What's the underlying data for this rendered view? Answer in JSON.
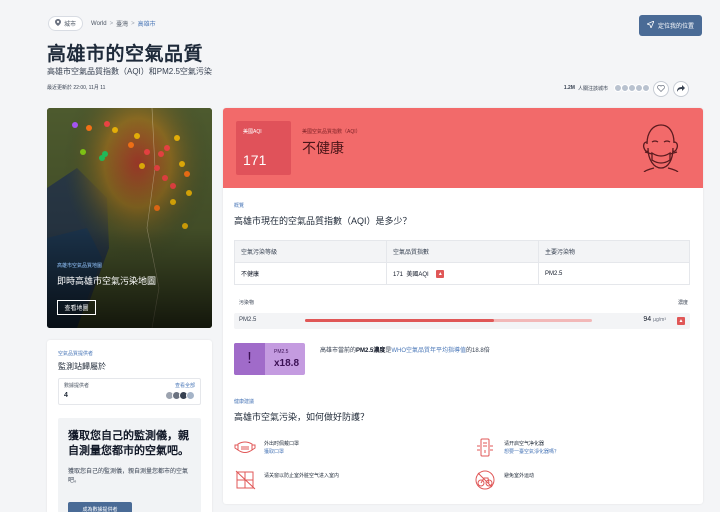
{
  "breadcrumb": {
    "pill": "城市",
    "items": [
      "World",
      "臺灣",
      "高雄市"
    ]
  },
  "header": {
    "locate_label": "定位我的位置",
    "title": "高雄市的空氣品質",
    "subtitle": "高雄市空氣品質指數（AQI）和PM2.5空氣污染",
    "updated": "最近更新於 22:00, 11月 11",
    "followers_count": "1.2M",
    "followers_label": "人關注該城市"
  },
  "map_card": {
    "small_label": "高雄市空氣品質地圖",
    "title": "即時高雄市空氣污染地圖",
    "button": "查看地圖"
  },
  "contributors": {
    "label": "空氣品質提供者",
    "title": "監測站歸屬於",
    "row_key": "數據提供者",
    "row_value": "4",
    "see_all": "查看全部",
    "promo_title": "獲取您自己的監測儀，親自測量您都市的空氣吧。",
    "promo_text": "獲取您自己的監測儀，親自測量您都市的空氣吧。",
    "promo_button": "成為數據提供者"
  },
  "aqi": {
    "box_label": "美國AQI",
    "value": "171",
    "status_label": "美國空氣品質指數（AQI）",
    "status": "不健康",
    "banner_color": "#f26a6a"
  },
  "overview": {
    "label": "概覽",
    "question": "高雄市現在的空氣品質指數（AQI）是多少？",
    "headers": [
      "空氣污染等級",
      "空氣品質指數",
      "主要污染物"
    ],
    "row": {
      "level": "不健康",
      "index": "171",
      "index_unit": "美國AQI",
      "pollutant": "PM2.5"
    }
  },
  "pollutants": {
    "head_left": "污染物",
    "head_right": "濃度",
    "name": "PM2.5",
    "value": "94",
    "unit": "µg/m³",
    "level_fraction": 0.66
  },
  "who": {
    "pollutant": "PM2.5",
    "multiplier": "x18.8",
    "text_prefix": "高雄市當前的",
    "text_bold": "PM2.5濃度",
    "text_mid": "是",
    "text_link": "WHO空氣品質年平均指導值",
    "text_suffix": "的18.8倍"
  },
  "recommendations": {
    "label": "健康建議",
    "question": "高雄市空氣污染，如何做好防護？",
    "items": [
      {
        "text": "外出时佩戴口罩",
        "sub": "獲取口罩",
        "icon": "mask-icon"
      },
      {
        "text": "请开启空气净化器",
        "sub": "想要一臺空氣淨化器嗎？",
        "icon": "air-purifier-icon"
      },
      {
        "text": "请关窗以防止室外脏空气进入室内",
        "sub": "",
        "icon": "window-closed-icon"
      },
      {
        "text": "避免室外运动",
        "sub": "",
        "icon": "no-bike-icon"
      }
    ]
  }
}
